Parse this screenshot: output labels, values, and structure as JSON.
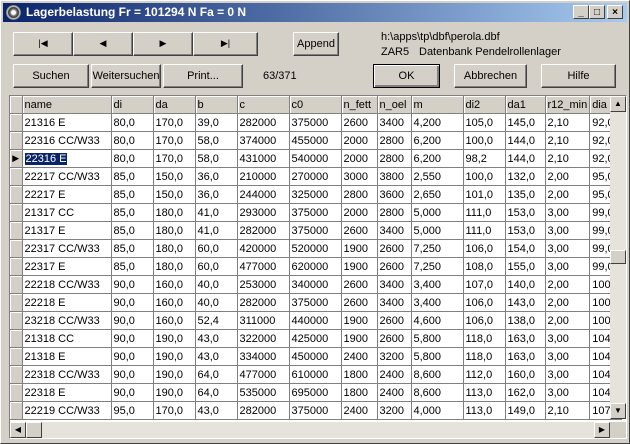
{
  "window": {
    "title": "Lagerbelastung Fr = 101294 N   Fa = 0 N",
    "minimize": "_",
    "maximize": "□",
    "close": "×"
  },
  "nav": {
    "first": "|◀",
    "prev": "◀",
    "next": "▶",
    "last": "▶|"
  },
  "buttons": {
    "append": "Append",
    "suchen": "Suchen",
    "weitersuchen": "Weitersuchen",
    "print": "Print...",
    "ok": "OK",
    "abbrechen": "Abbrechen",
    "hilfe": "Hilfe"
  },
  "info": {
    "path": "h:\\apps\\tp\\dbf\\perola.dbf",
    "db_code": "ZAR5",
    "db_name": "Datenbank Pendelrollenlager",
    "record_pos": "63/371"
  },
  "table": {
    "columns": [
      "name",
      "di",
      "da",
      "b",
      "c",
      "c0",
      "n_fett",
      "n_oel",
      "m",
      "di2",
      "da1",
      "r12_min",
      "dia"
    ],
    "selected_row": 2,
    "rows": [
      [
        "21316 E",
        "80,0",
        "170,0",
        "39,0",
        "282000",
        "375000",
        "2600",
        "3400",
        "4,200",
        "105,0",
        "145,0",
        "2,10",
        "92,0"
      ],
      [
        "22316 CC/W33",
        "80,0",
        "170,0",
        "58,0",
        "374000",
        "455000",
        "2000",
        "2800",
        "6,200",
        "100,0",
        "144,0",
        "2,10",
        "92,0"
      ],
      [
        "22316 E",
        "80,0",
        "170,0",
        "58,0",
        "431000",
        "540000",
        "2000",
        "2800",
        "6,200",
        "98,2",
        "144,0",
        "2,10",
        "92,0"
      ],
      [
        "22217 CC/W33",
        "85,0",
        "150,0",
        "36,0",
        "210000",
        "270000",
        "3000",
        "3800",
        "2,550",
        "100,0",
        "132,0",
        "2,00",
        "95,0"
      ],
      [
        "22217 E",
        "85,0",
        "150,0",
        "36,0",
        "244000",
        "325000",
        "2800",
        "3600",
        "2,650",
        "101,0",
        "135,0",
        "2,00",
        "95,0"
      ],
      [
        "21317 CC",
        "85,0",
        "180,0",
        "41,0",
        "293000",
        "375000",
        "2000",
        "2800",
        "5,000",
        "111,0",
        "153,0",
        "3,00",
        "99,0"
      ],
      [
        "21317 E",
        "85,0",
        "180,0",
        "41,0",
        "282000",
        "375000",
        "2600",
        "3400",
        "5,000",
        "111,0",
        "153,0",
        "3,00",
        "99,0"
      ],
      [
        "22317 CC/W33",
        "85,0",
        "180,0",
        "60,0",
        "420000",
        "520000",
        "1900",
        "2600",
        "7,250",
        "106,0",
        "154,0",
        "3,00",
        "99,0"
      ],
      [
        "22317 E",
        "85,0",
        "180,0",
        "60,0",
        "477000",
        "620000",
        "1900",
        "2600",
        "7,250",
        "108,0",
        "155,0",
        "3,00",
        "99,0"
      ],
      [
        "22218 CC/W33",
        "90,0",
        "160,0",
        "40,0",
        "253000",
        "340000",
        "2600",
        "3400",
        "3,400",
        "107,0",
        "140,0",
        "2,00",
        "100"
      ],
      [
        "22218 E",
        "90,0",
        "160,0",
        "40,0",
        "282000",
        "375000",
        "2600",
        "3400",
        "3,400",
        "106,0",
        "143,0",
        "2,00",
        "100"
      ],
      [
        "23218 CC/W33",
        "90,0",
        "160,0",
        "52,4",
        "311000",
        "440000",
        "1900",
        "2600",
        "4,600",
        "106,0",
        "138,0",
        "2,00",
        "100"
      ],
      [
        "21318 CC",
        "90,0",
        "190,0",
        "43,0",
        "322000",
        "425000",
        "1900",
        "2600",
        "5,800",
        "118,0",
        "163,0",
        "3,00",
        "104"
      ],
      [
        "21318 E",
        "90,0",
        "190,0",
        "43,0",
        "334000",
        "450000",
        "2400",
        "3200",
        "5,800",
        "118,0",
        "163,0",
        "3,00",
        "104"
      ],
      [
        "22318 CC/W33",
        "90,0",
        "190,0",
        "64,0",
        "477000",
        "610000",
        "1800",
        "2400",
        "8,600",
        "112,0",
        "160,0",
        "3,00",
        "104"
      ],
      [
        "22318 E",
        "90,0",
        "190,0",
        "64,0",
        "535000",
        "695000",
        "1800",
        "2400",
        "8,600",
        "113,0",
        "162,0",
        "3,00",
        "104"
      ],
      [
        "22219 CC/W33",
        "95,0",
        "170,0",
        "43,0",
        "282000",
        "375000",
        "2400",
        "3200",
        "4,000",
        "113,0",
        "149,0",
        "2,10",
        "107"
      ]
    ]
  }
}
